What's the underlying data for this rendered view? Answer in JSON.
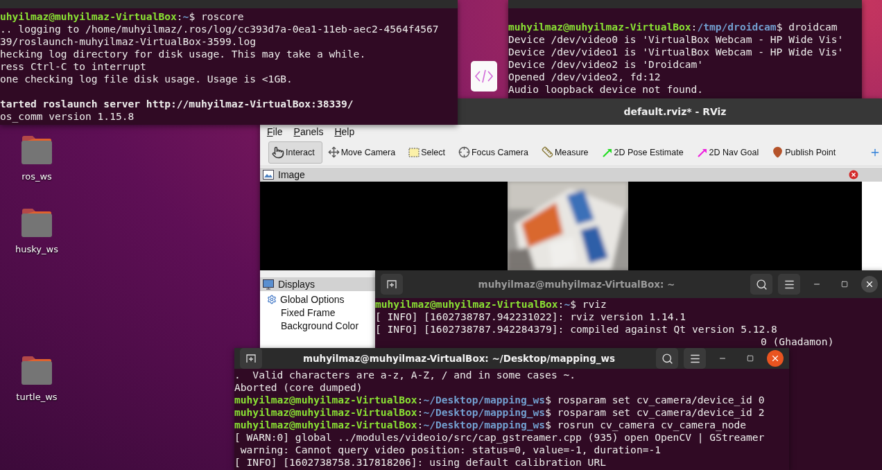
{
  "desktop_icons": [
    {
      "label": "ros_ws"
    },
    {
      "label": "husky_ws"
    },
    {
      "label": "turtle_ws"
    }
  ],
  "terminal_top_right": {
    "focused": false,
    "lines": [
      {
        "kind": "blank"
      },
      {
        "kind": "prompt",
        "user": "muhyilmaz@muhyilmaz-VirtualBox",
        "sep": ":",
        "path": "/tmp/droidcam",
        "command": "$ droidcam"
      },
      {
        "kind": "output",
        "text": "Device /dev/video0 is 'VirtualBox Webcam - HP Wide Vis'"
      },
      {
        "kind": "output",
        "text": "Device /dev/video1 is 'VirtualBox Webcam - HP Wide Vis'"
      },
      {
        "kind": "output",
        "text": "Device /dev/video2 is 'Droidcam'"
      },
      {
        "kind": "output",
        "text": "Opened /dev/video2, fd:12"
      },
      {
        "kind": "output",
        "text": "Audio loopback device not found."
      }
    ]
  },
  "rviz": {
    "title": "default.rviz* - RViz",
    "menu": [
      "File",
      "Panels",
      "Help"
    ],
    "tools": [
      {
        "kind": "interact",
        "label": "Interact",
        "selected": true
      },
      {
        "kind": "move",
        "label": "Move Camera",
        "selected": false
      },
      {
        "kind": "select",
        "label": "Select",
        "selected": false
      },
      {
        "kind": "focus",
        "label": "Focus Camera",
        "selected": false
      },
      {
        "kind": "measure",
        "label": "Measure",
        "selected": false
      },
      {
        "kind": "pose",
        "label": "2D Pose Estimate",
        "selected": false
      },
      {
        "kind": "goal",
        "label": "2D Nav Goal",
        "selected": false
      },
      {
        "kind": "point",
        "label": "Publish Point",
        "selected": false
      }
    ],
    "image_panel": {
      "title": "Image"
    },
    "displays_panel": {
      "title": "Displays",
      "items": [
        {
          "label": "Global Options",
          "children": [
            {
              "label": "Fixed Frame"
            },
            {
              "label": "Background Color"
            }
          ]
        }
      ]
    }
  },
  "terminal_top_left": {
    "focused": false,
    "lines": [
      {
        "kind": "prompt",
        "user": "uhyilmaz@muhyilmaz-VirtualBox",
        "sep": ":",
        "path": "~",
        "command": "$ roscore"
      },
      {
        "kind": "output",
        "text": ".. logging to /home/muhyilmaz/.ros/log/cc393d7a-0ea1-11eb-aec2-4564f4567"
      },
      {
        "kind": "output",
        "text": "39/roslaunch-muhyilmaz-VirtualBox-3599.log"
      },
      {
        "kind": "output",
        "text": "hecking log directory for disk usage. This may take a while."
      },
      {
        "kind": "output",
        "text": "ress Ctrl-C to interrupt"
      },
      {
        "kind": "output",
        "text": "one checking log file disk usage. Usage is <1GB."
      },
      {
        "kind": "blank"
      },
      {
        "kind": "bold",
        "text": "tarted roslaunch server http://muhyilmaz-VirtualBox:38339/"
      },
      {
        "kind": "output",
        "text": "os_comm version 1.15.8"
      }
    ]
  },
  "terminal_middle": {
    "title": "muhyilmaz@muhyilmaz-VirtualBox: ~",
    "focused": false,
    "lines": [
      {
        "kind": "prompt",
        "user": "muhyilmaz@muhyilmaz-VirtualBox",
        "sep": ":",
        "path": "~",
        "command": "$ rviz"
      },
      {
        "kind": "output",
        "text": "[ INFO] [1602738787.942231022]: rviz version 1.14.1"
      },
      {
        "kind": "output",
        "text": "[ INFO] [1602738787.942284379]: compiled against Qt version 5.12.8"
      },
      {
        "kind": "tail",
        "text": "0 (Ghadamon)"
      }
    ]
  },
  "terminal_bottom": {
    "title": "muhyilmaz@muhyilmaz-VirtualBox: ~/Desktop/mapping_ws",
    "focused": true,
    "lines": [
      {
        "kind": "output",
        "text": ".  Valid characters are a-z, A-Z, / and in some cases ~."
      },
      {
        "kind": "output",
        "text": "Aborted (core dumped)"
      },
      {
        "kind": "prompt",
        "user": "muhyilmaz@muhyilmaz-VirtualBox",
        "sep": ":",
        "path": "~/Desktop/mapping_ws",
        "command": "$ rosparam set cv_camera/device_id 0"
      },
      {
        "kind": "prompt",
        "user": "muhyilmaz@muhyilmaz-VirtualBox",
        "sep": ":",
        "path": "~/Desktop/mapping_ws",
        "command": "$ rosparam set cv_camera/device_id 2"
      },
      {
        "kind": "prompt",
        "user": "muhyilmaz@muhyilmaz-VirtualBox",
        "sep": ":",
        "path": "~/Desktop/mapping_ws",
        "command": "$ rosrun cv_camera cv_camera_node"
      },
      {
        "kind": "output",
        "text": "[ WARN:0] global ../modules/videoio/src/cap_gstreamer.cpp (935) open OpenCV | GStreamer"
      },
      {
        "kind": "output",
        "text": " warning: Cannot query video position: status=0, value=-1, duration=-1"
      },
      {
        "kind": "output",
        "text": "[ INFO] [1602738758.317818206]: using default calibration URL"
      }
    ]
  }
}
